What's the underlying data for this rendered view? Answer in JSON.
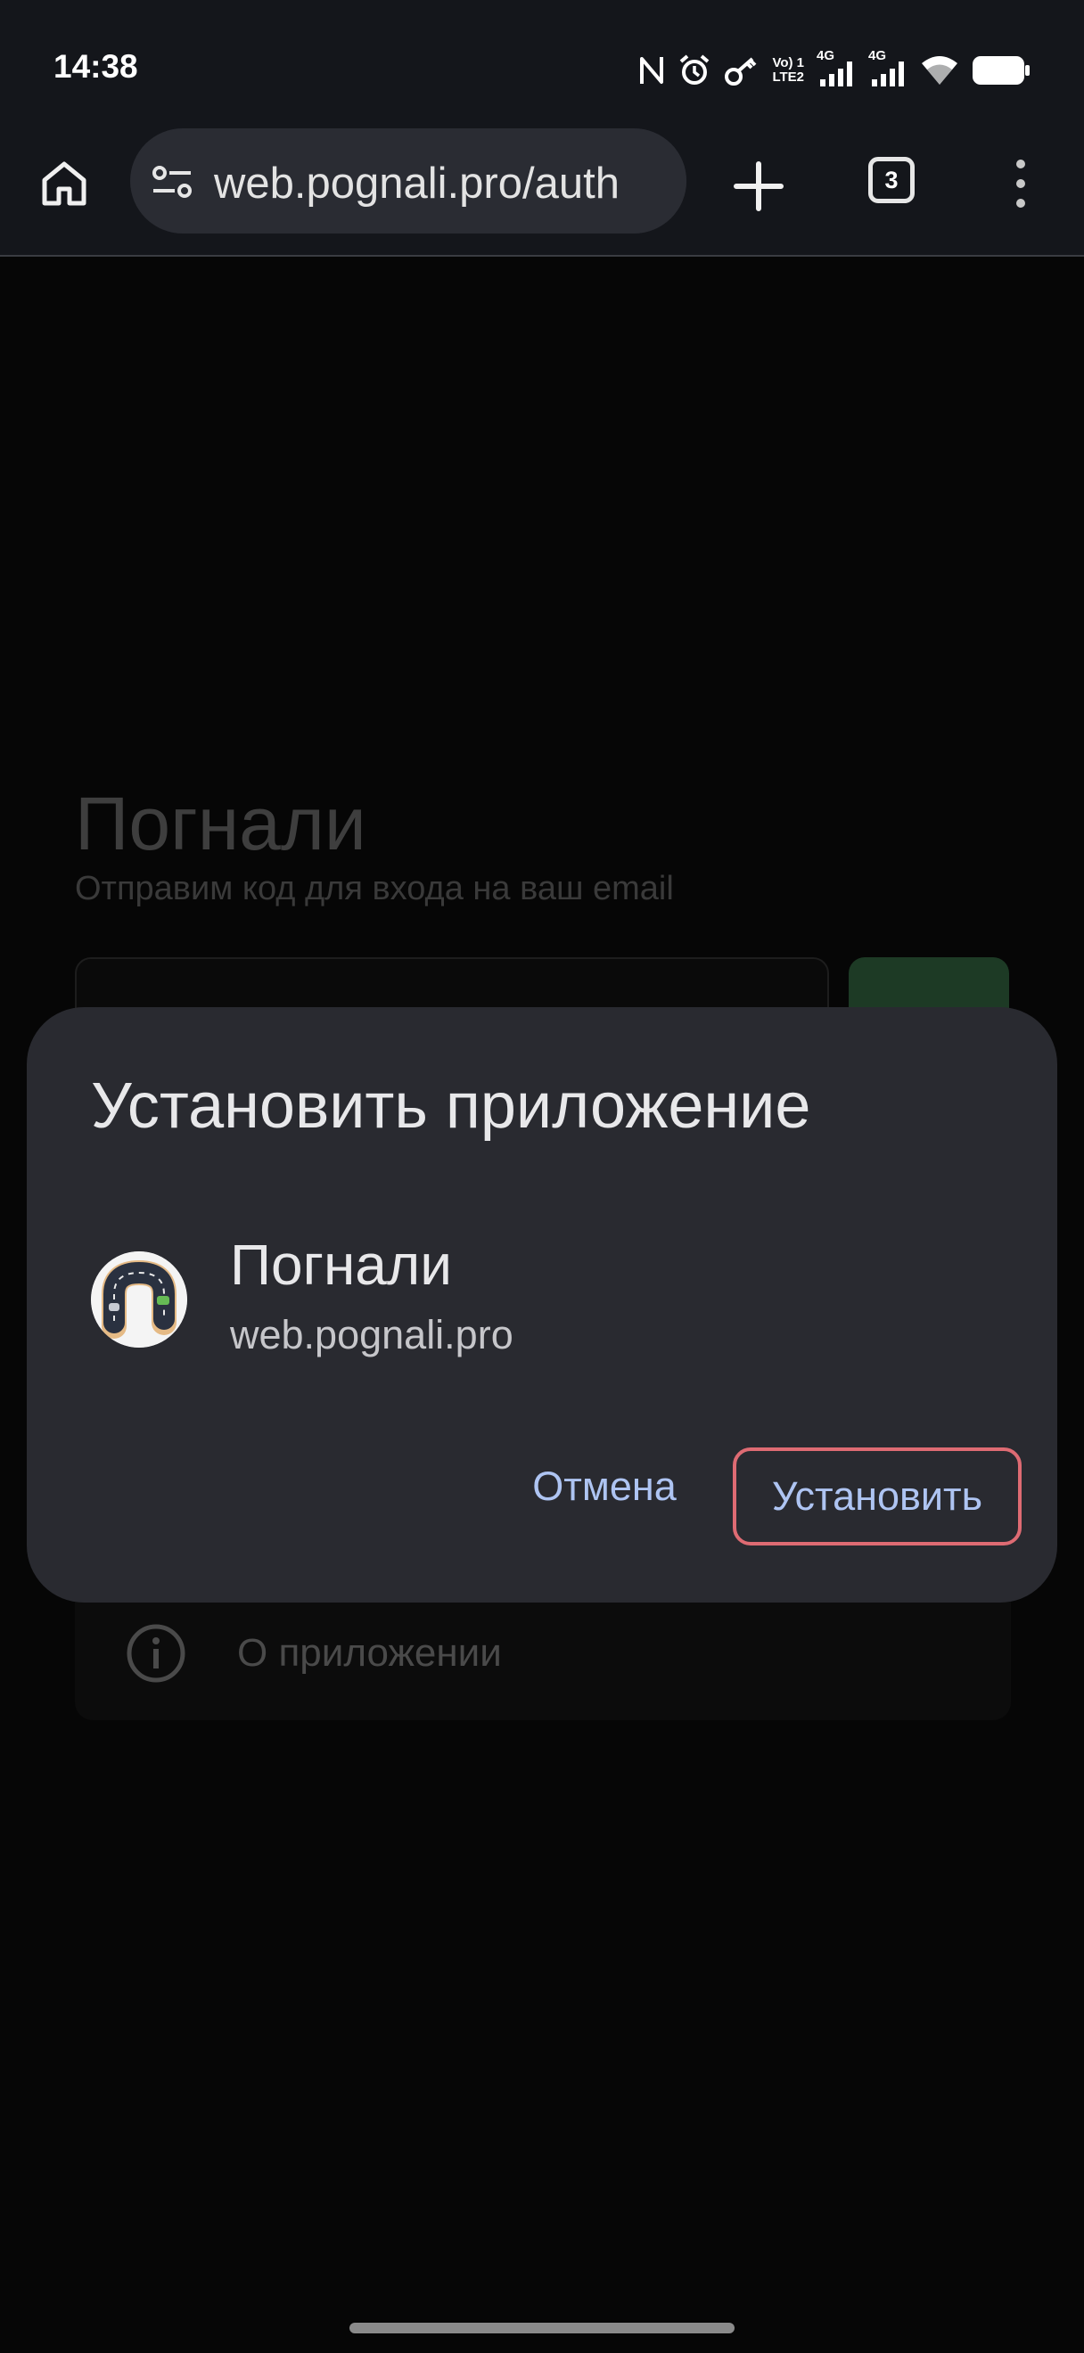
{
  "status_bar": {
    "time": "14:38",
    "icons": [
      "nfc-icon",
      "alarm-icon",
      "vpn-key-icon",
      "volte-icon",
      "signal-4g-sim1-icon",
      "signal-4g-sim2-icon",
      "wifi-icon",
      "battery-icon"
    ],
    "volte_label": "Vo) 1",
    "lte_label": "LTE2",
    "net1_label": "4G",
    "net2_label": "4G"
  },
  "browser": {
    "url": "web.pognali.pro/auth",
    "tab_count": "3",
    "icons": [
      "home-icon",
      "site-settings-icon",
      "plus-icon",
      "more-vert-icon"
    ]
  },
  "page": {
    "title": "Погнали",
    "subtitle": "Отправим код для входа на ваш email",
    "about_label": "О приложении"
  },
  "dialog": {
    "title": "Установить приложение",
    "app_name": "Погнали",
    "app_url": "web.pognali.pro",
    "cancel_label": "Отмена",
    "install_label": "Установить"
  },
  "colors": {
    "accent_text": "#aec4f2",
    "install_outline": "#de6b73",
    "dialog_bg": "#292a30",
    "toolbar_bg": "#14161b"
  }
}
